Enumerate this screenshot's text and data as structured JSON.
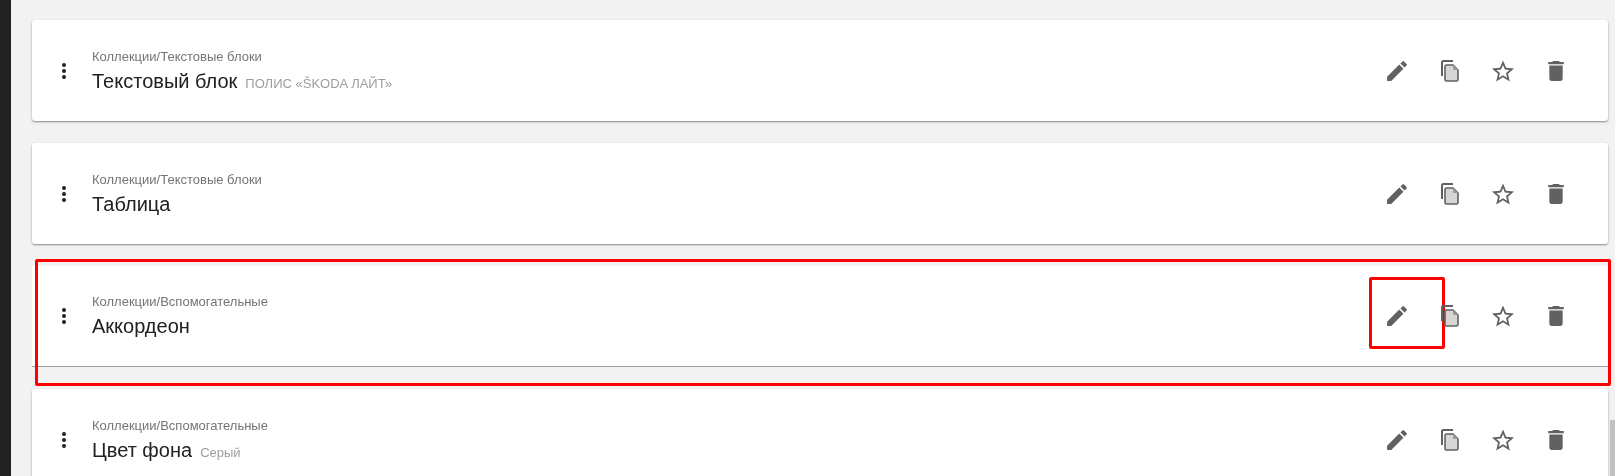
{
  "items": [
    {
      "category": "Коллекции/Текстовые блоки",
      "title": "Текстовый блок",
      "subtitle": "ПОЛИС «ŠKODA ЛАЙТ»",
      "highlighted": false,
      "actions": [
        {
          "kind": "edit",
          "highlighted": false
        },
        {
          "kind": "copy",
          "highlighted": false
        },
        {
          "kind": "favorite",
          "highlighted": false
        },
        {
          "kind": "delete",
          "highlighted": false
        }
      ]
    },
    {
      "category": "Коллекции/Текстовые блоки",
      "title": "Таблица",
      "highlighted": false,
      "actions": [
        {
          "kind": "edit",
          "highlighted": false
        },
        {
          "kind": "copy",
          "highlighted": false
        },
        {
          "kind": "favorite",
          "highlighted": false
        },
        {
          "kind": "delete",
          "highlighted": false
        }
      ]
    },
    {
      "category": "Коллекции/Вспомогательные",
      "title": "Аккордеон",
      "highlighted": true,
      "actions": [
        {
          "kind": "edit",
          "highlighted": true
        },
        {
          "kind": "copy",
          "highlighted": false
        },
        {
          "kind": "favorite",
          "highlighted": false
        },
        {
          "kind": "delete",
          "highlighted": false
        }
      ]
    },
    {
      "category": "Коллекции/Вспомогательные",
      "title": "Цвет фона",
      "subtitle": "Серый",
      "highlighted": false,
      "actions": [
        {
          "kind": "edit",
          "highlighted": false
        },
        {
          "kind": "copy",
          "highlighted": false
        },
        {
          "kind": "favorite",
          "highlighted": false
        },
        {
          "kind": "delete",
          "highlighted": false
        }
      ]
    }
  ]
}
